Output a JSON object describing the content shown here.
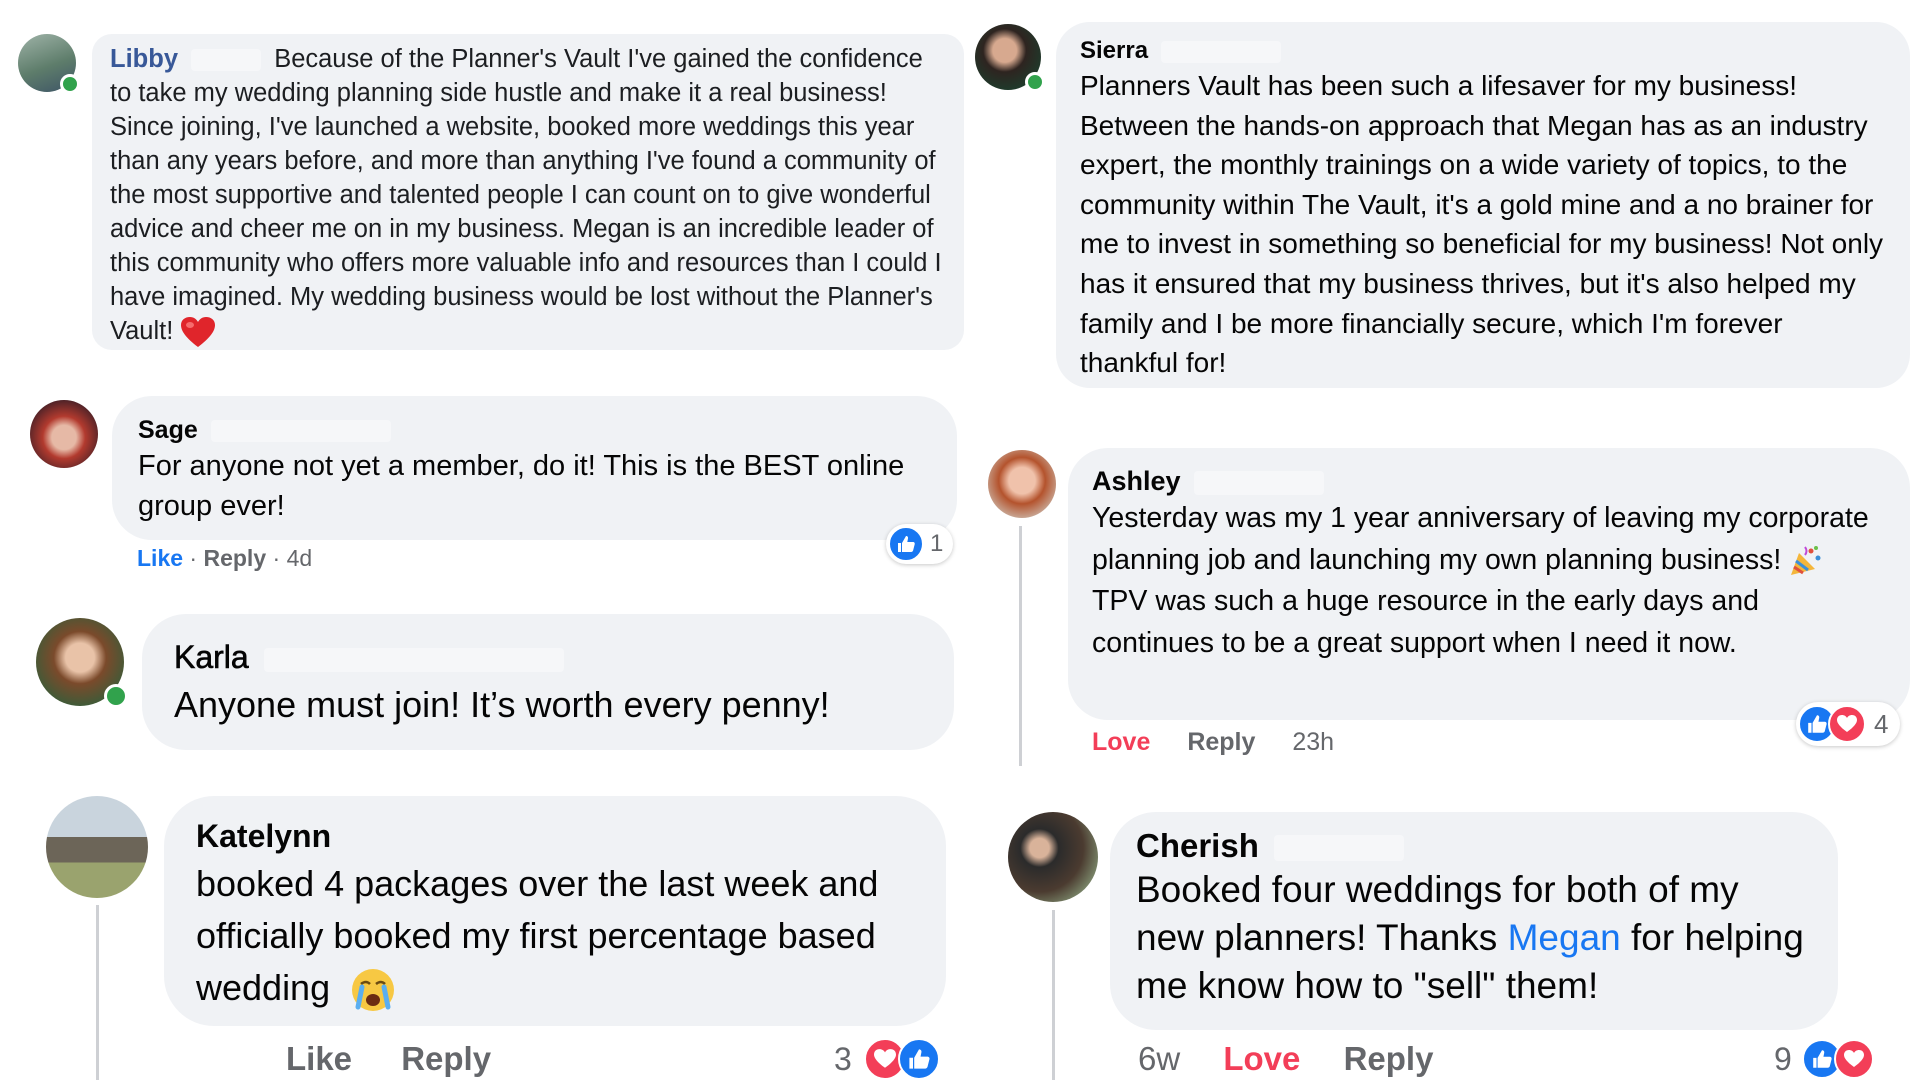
{
  "comments": {
    "libby": {
      "name": "Libby",
      "text": "Because of the Planner's Vault I've gained the confidence to take my wedding planning side hustle and make it a real business! Since joining, I've launched a website, booked more weddings this year than any years before, and more than anything I've found a community of the most supportive and talented people I can count on to give wonderful advice and cheer me on in my business. Megan is an incredible leader of this community who offers more valuable info and resources than I could I have imagined. My wedding business would be lost without the Planner's Vault!",
      "emoji": "heart-emoji"
    },
    "sierra": {
      "name": "Sierra",
      "text": "Planners Vault has been such a lifesaver for my business! Between the hands-on approach that Megan has as an industry expert, the monthly trainings on a wide variety of topics, to the community within The Vault, it's a gold mine and a no brainer for me to invest in something so beneficial for my business! Not only has it ensured that my business thrives, but it's also helped my family and I be more financially secure, which I'm forever thankful for!"
    },
    "sage": {
      "name": "Sage",
      "text": "For anyone not yet a member, do it! This is the BEST online group ever!",
      "actions": {
        "like": "Like",
        "sep1": " · ",
        "reply": "Reply",
        "sep2": " · ",
        "time": "4d"
      },
      "reaction_count": "1"
    },
    "ashley": {
      "name": "Ashley",
      "line1": "Yesterday was my 1 year anniversary of leaving my corporate planning job and launching my own planning business!",
      "line2": "TPV was such a huge resource in the early days and continues to be a great support when I need it now.",
      "emoji": "party-popper-emoji",
      "actions": {
        "love": "Love",
        "reply": "Reply",
        "time": "23h"
      },
      "reaction_count": "4"
    },
    "karla": {
      "name": "Karla",
      "text": "Anyone must join! It’s worth every penny!"
    },
    "katelynn": {
      "name": "Katelynn",
      "text": "booked 4 packages over the last week and officially booked my first percentage based wedding",
      "emoji": "crying-face-emoji",
      "actions": {
        "like": "Like",
        "reply": "Reply"
      },
      "reaction_count": "3"
    },
    "cherish": {
      "name": "Cherish",
      "text_before": "Booked four weddings for both of my new planners! Thanks ",
      "mention": "Megan",
      "text_after": " for helping me know how to \"sell\" them!",
      "actions": {
        "time": "6w",
        "love": "Love",
        "reply": "Reply"
      },
      "reaction_count": "9"
    }
  },
  "colors": {
    "bubble": "#f0f2f5",
    "link_blue": "#1877f2",
    "love_red": "#f33e58",
    "meta_gray": "#65676b",
    "online_green": "#31a24c"
  }
}
